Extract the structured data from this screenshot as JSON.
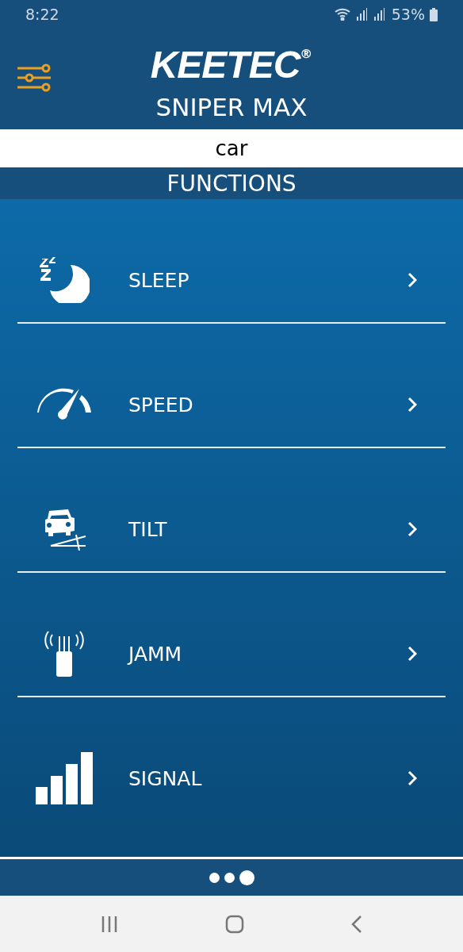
{
  "status_bar": {
    "time": "8:22",
    "battery": "53%"
  },
  "header": {
    "brand": "KEETEC",
    "brand_mark": "®",
    "model": "SNIPER MAX"
  },
  "device": {
    "name": "car"
  },
  "section": {
    "title": "FUNCTIONS"
  },
  "functions": [
    {
      "kind": "sleep",
      "label": "SLEEP"
    },
    {
      "kind": "speed",
      "label": "SPEED"
    },
    {
      "kind": "tilt",
      "label": "TILT"
    },
    {
      "kind": "jamm",
      "label": "JAMM"
    },
    {
      "kind": "signal",
      "label": "SIGNAL"
    }
  ],
  "pages": [
    {
      "selected": false
    },
    {
      "selected": false
    },
    {
      "selected": true
    }
  ]
}
